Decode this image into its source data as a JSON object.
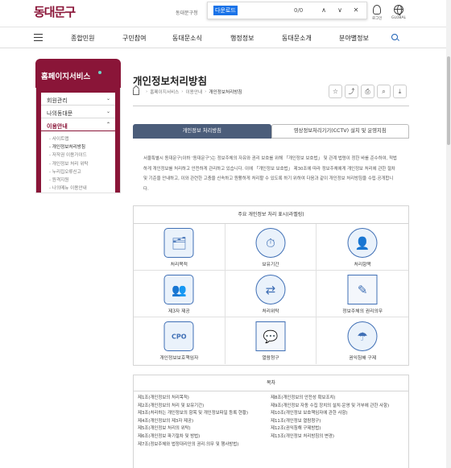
{
  "header": {
    "logo": "동대문구",
    "site_sub": "동대문구청",
    "find": {
      "query": "다운로드",
      "count": "0/0",
      "prev": "∧",
      "next": "∨",
      "close": "✕"
    },
    "login_label": "로그인",
    "global_label": "GLOBAL"
  },
  "gnb": [
    "종합민원",
    "구민참여",
    "동대문소식",
    "행정정보",
    "동대문소개",
    "분야별정보"
  ],
  "sidebar": {
    "title": "홈페이지서비스",
    "items": [
      {
        "label": "회원관리",
        "chev": "⌄"
      },
      {
        "label": "나의동대문",
        "chev": "⌄"
      },
      {
        "label": "이용안내",
        "chev": "⌃"
      }
    ],
    "sub_items": [
      "사이트맵",
      "개인정보처리방침",
      "저작권 이용가이드",
      "개인정보 처리 위탁",
      "누리집오류신고",
      "원격지원",
      "나의메뉴 이용안내"
    ]
  },
  "page": {
    "title": "개인정보처리방침",
    "breadcrumb": [
      "홈페이지서비스",
      "이용안내",
      "개인정보처리방침"
    ],
    "tools": [
      "☆",
      "⤴",
      "⎙",
      "⌕",
      "⤓"
    ]
  },
  "tabs": [
    "개인정보 처리방침",
    "영상정보처리기기(CCTV) 설치 및 운영지침"
  ],
  "intro": "서울특별시 동대문구(이하 '동대문구')는 정보주체의 자유와 권리 보호를 위해 「개인정보 보호법」 및 관계 법령이 정한 바를 준수하여, 적법하게 개인정보를 처리하고 안전하게 관리하고 있습니다. 이에 「개인정보 보호법」 제30조에 따라 정보주체에게 개인정보 처리에 관한 절차 및 기준을 안내하고, 이와 관련한 고충을 신속하고 원활하게 처리할 수 있도록 하기 위하여 다음과 같이 개인정보 처리방침을 수립·공개합니다.",
  "principles": {
    "title": "주요 개인정보 처리 표시(라벨링)",
    "items": [
      {
        "label": "처리목적",
        "icon": "folder-check-icon",
        "glyph": "🗂"
      },
      {
        "label": "보유기간",
        "icon": "calendar-clock-icon",
        "glyph": "⏱"
      },
      {
        "label": "처리항목",
        "icon": "folder-person-icon",
        "glyph": "👤"
      },
      {
        "label": "제3자 제공",
        "icon": "people-share-icon",
        "glyph": "👥"
      },
      {
        "label": "처리위탁",
        "icon": "handover-icon",
        "glyph": "⇄"
      },
      {
        "label": "정보주체의 권리의무",
        "icon": "document-pen-icon",
        "glyph": "✎"
      },
      {
        "label": "개인정보보호책임자",
        "icon": "cpo-badge-icon",
        "glyph": "CPO"
      },
      {
        "label": "열람청구",
        "icon": "chat-icon",
        "glyph": "💬"
      },
      {
        "label": "권익침해 구제",
        "icon": "umbrella-icon",
        "glyph": "☂"
      }
    ]
  },
  "toc": {
    "title": "목차",
    "left": [
      "제1조(개인정보의 처리목적)",
      "제2조(개인정보의 처리 및 보유기간)",
      "제3조(처리하는 개인정보의 항목 및 개인정보파일 등록 현황)",
      "제4조(개인정보의 제3자 제공)",
      "제5조(개인정보 처리의 위탁)",
      "제6조(개인정보 파기절차 및 방법)",
      "제7조(정보주체와 법정대리인의 권리·의무 및 행사방법)"
    ],
    "right": [
      "제8조(개인정보의 안전성 확보조치)",
      "제9조(개인정보 자동 수집 장치의 설치·운영 및 거부에 관한 사항)",
      "제10조(개인정보 보호책임자에 관한 사항)",
      "제11조(개인정보 열람청구)",
      "제12조(권익침해 구제방법)",
      "제13조(개인정보 처리방침의 변경)"
    ]
  }
}
